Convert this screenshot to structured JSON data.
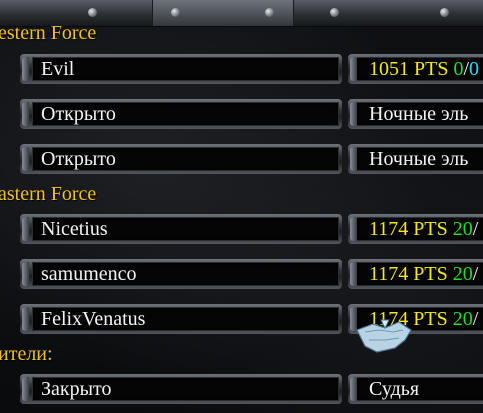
{
  "teams": [
    {
      "header": "estern Force",
      "players": [
        {
          "name": "Evil",
          "status_color": "white",
          "pts": "1051 PTS",
          "w": "0",
          "sep": "/",
          "l": "0",
          "race": ""
        },
        {
          "name": "Открыто",
          "status_color": "green",
          "race": "Ночные эль"
        },
        {
          "name": "Открыто",
          "status_color": "green",
          "race": "Ночные эль"
        }
      ]
    },
    {
      "header": "astern Force",
      "players": [
        {
          "name": "Nicetius",
          "status_color": "white",
          "pts": "1174 PTS",
          "w": "20",
          "sep": "/"
        },
        {
          "name": "samumenco",
          "status_color": "white",
          "pts": "1174 PTS",
          "w": "20",
          "sep": "/"
        },
        {
          "name": "FelixVenatus",
          "status_color": "white",
          "pts": "1174 PTS",
          "w": "20",
          "sep": "/"
        }
      ]
    },
    {
      "header": "ители:",
      "players": [
        {
          "name": "Закрыто",
          "status_color": "red",
          "race": "Судья"
        }
      ]
    }
  ],
  "colors": {
    "header": "#f2c21a",
    "open": "#1fe01f",
    "closed": "#e41a1a",
    "pts": "#f4e81c",
    "wins_zero": "#1fe01f",
    "losses_zero": "#1fe0ff"
  }
}
